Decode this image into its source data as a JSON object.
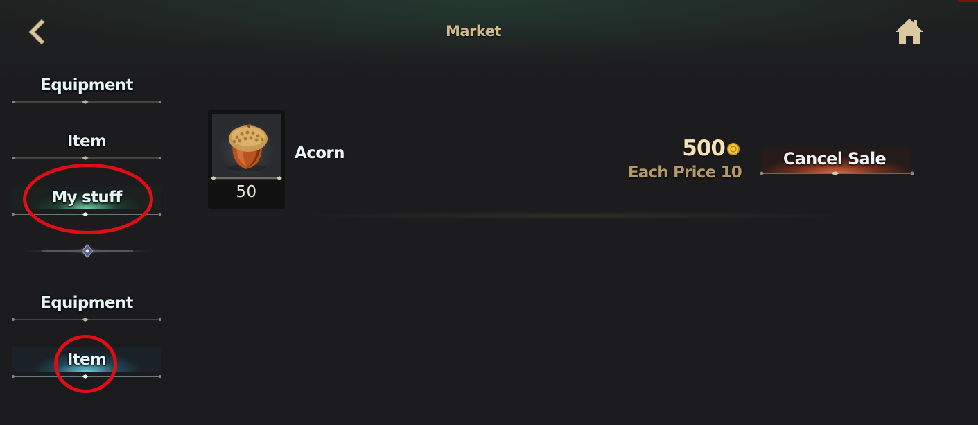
{
  "header": {
    "title": "Market",
    "back_icon": "chevron-left-icon",
    "home_icon": "home-icon"
  },
  "sidebar": {
    "groups": [
      {
        "items": [
          {
            "label": "Equipment",
            "active": false
          },
          {
            "label": "Item",
            "active": false
          },
          {
            "label": "My stuff",
            "active": true
          }
        ]
      },
      {
        "items": [
          {
            "label": "Equipment",
            "active": false
          },
          {
            "label": "Item",
            "active": true
          }
        ]
      }
    ]
  },
  "listing": {
    "item_name": "Acorn",
    "quantity": "50",
    "total_price": "500",
    "each_price": "Each Price 10",
    "currency_icon": "gold-coin-icon",
    "cancel_label": "Cancel Sale"
  },
  "colors": {
    "title": "#d3b98c",
    "price": "#f6e3b4",
    "each_price": "#b49a62",
    "annotation": "#e10d14",
    "active_green": "#78e6b4",
    "active_blue": "#78e6f5",
    "cancel_orange": "#e67846"
  }
}
